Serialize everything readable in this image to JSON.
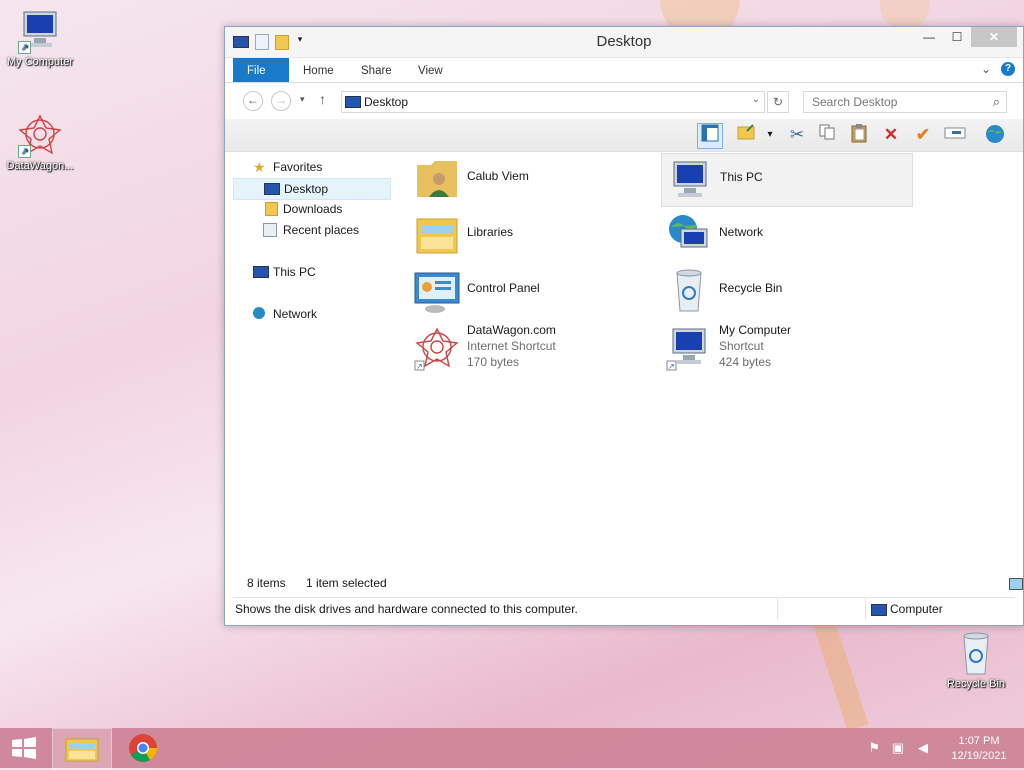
{
  "desktop": {
    "icons": [
      {
        "label": "My Computer"
      },
      {
        "label": "DataWagon..."
      },
      {
        "label": "Recycle Bin"
      }
    ]
  },
  "window": {
    "title": "Desktop",
    "ribbon": {
      "file": "File",
      "home": "Home",
      "share": "Share",
      "view": "View"
    },
    "address": {
      "path": "Desktop"
    },
    "search": {
      "placeholder": "Search Desktop"
    },
    "nav": {
      "favorites": "Favorites",
      "desktop": "Desktop",
      "downloads": "Downloads",
      "recent": "Recent places",
      "thispc": "This PC",
      "network": "Network"
    },
    "items": [
      {
        "name": "Calub Viem"
      },
      {
        "name": "This PC"
      },
      {
        "name": "Libraries"
      },
      {
        "name": "Network"
      },
      {
        "name": "Control Panel"
      },
      {
        "name": "Recycle Bin"
      },
      {
        "name": "DataWagon.com",
        "type": "Internet Shortcut",
        "size": "170 bytes"
      },
      {
        "name": "My Computer",
        "type": "Shortcut",
        "size": "424 bytes"
      }
    ],
    "status": {
      "count": "8 items",
      "selected": "1 item selected"
    },
    "info": {
      "text": "Shows the disk drives and hardware connected to this computer.",
      "location": "Computer"
    }
  },
  "taskbar": {
    "time": "1:07 PM",
    "date": "12/19/2021"
  },
  "colors": {
    "accent": "#1979ca",
    "taskbar": "#cd8296"
  }
}
